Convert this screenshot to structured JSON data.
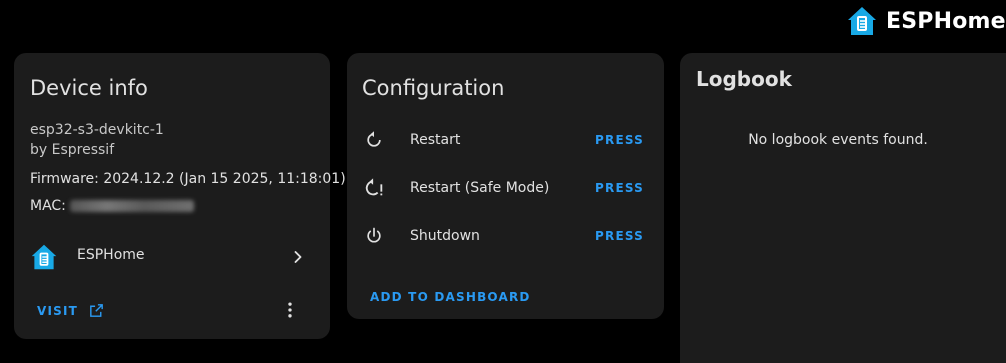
{
  "brand": {
    "name": "ESPHome",
    "logo_color": "#18a9e6"
  },
  "device_card": {
    "title": "Device info",
    "model": "esp32-s3-devkitc-1",
    "manufacturer": "by Espressif",
    "firmware": "Firmware: 2024.12.2 (Jan 15 2025, 11:18:01)",
    "mac_label": "MAC:",
    "integration_name": "ESPHome",
    "visit_label": "VISIT"
  },
  "config_card": {
    "title": "Configuration",
    "items": [
      {
        "label": "Restart",
        "action": "PRESS",
        "icon": "restart-icon"
      },
      {
        "label": "Restart (Safe Mode)",
        "action": "PRESS",
        "icon": "restart-alert-icon"
      },
      {
        "label": "Shutdown",
        "action": "PRESS",
        "icon": "power-icon"
      }
    ],
    "add_label": "ADD TO DASHBOARD"
  },
  "logbook_card": {
    "title": "Logbook",
    "empty_text": "No logbook events found."
  },
  "colors": {
    "background": "#000000",
    "card": "#1c1c1c",
    "accent": "#2a9af2",
    "text": "#e1e1e1"
  }
}
